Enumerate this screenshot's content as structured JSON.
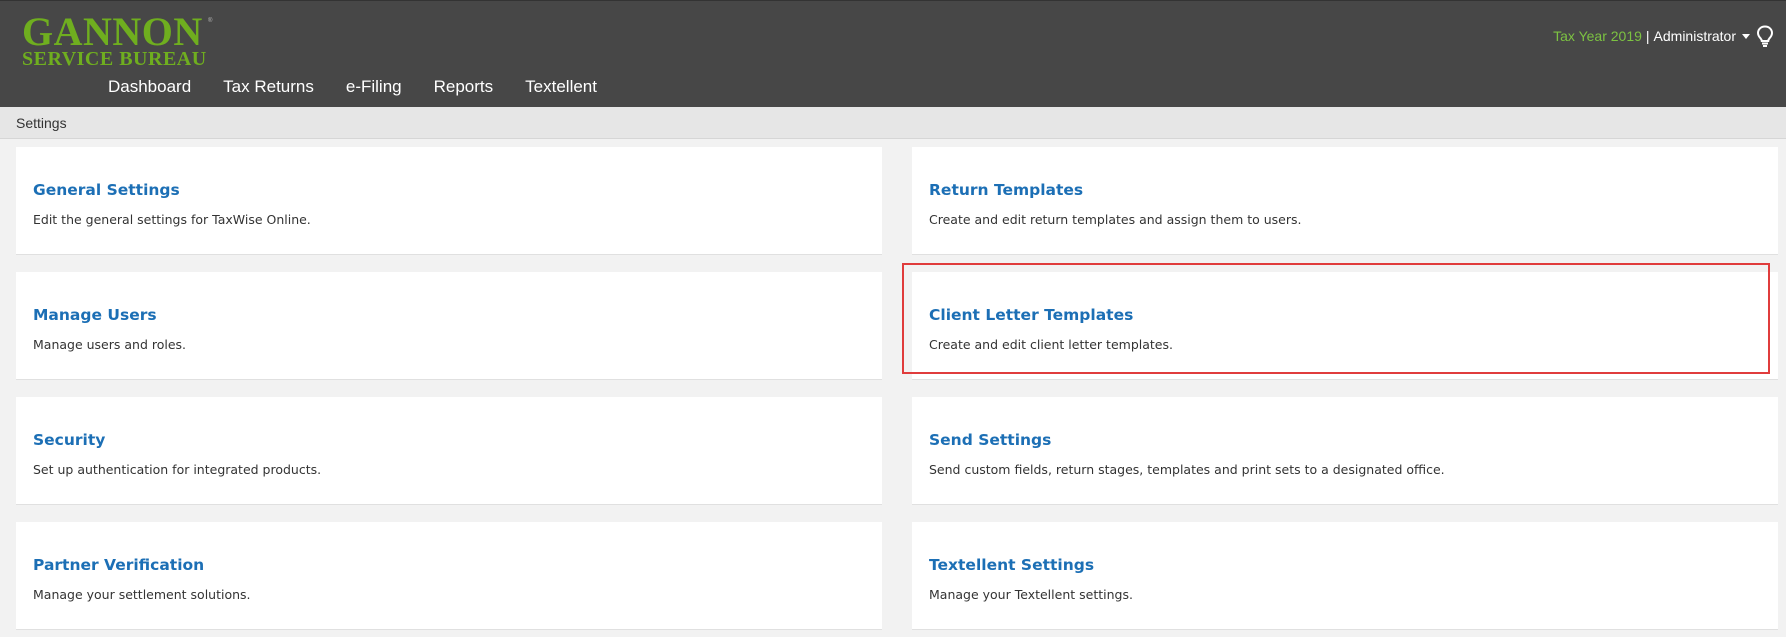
{
  "header": {
    "logo": {
      "line1": "GANNON",
      "line2": "SERVICE BUREAU",
      "tm": "®"
    },
    "nav": [
      {
        "label": "Dashboard"
      },
      {
        "label": "Tax Returns"
      },
      {
        "label": "e-Filing"
      },
      {
        "label": "Reports"
      },
      {
        "label": "Textellent"
      }
    ],
    "tax_year": "Tax Year 2019",
    "separator": "|",
    "user": "Administrator",
    "icons": {
      "caret": "caret-down-icon",
      "bulb": "lightbulb-icon"
    }
  },
  "breadcrumb": {
    "label": "Settings"
  },
  "cards": [
    {
      "title": "General Settings",
      "desc": "Edit the general settings for TaxWise Online."
    },
    {
      "title": "Return Templates",
      "desc": "Create and edit return templates and assign them to users."
    },
    {
      "title": "Manage Users",
      "desc": "Manage users and roles."
    },
    {
      "title": "Client Letter Templates",
      "desc": "Create and edit client letter templates."
    },
    {
      "title": "Security",
      "desc": "Set up authentication for integrated products."
    },
    {
      "title": "Send Settings",
      "desc": "Send custom fields, return stages, templates and print sets to a designated office."
    },
    {
      "title": "Partner Verification",
      "desc": "Manage your settlement solutions."
    },
    {
      "title": "Textellent Settings",
      "desc": "Manage your Textellent settings."
    }
  ],
  "colors": {
    "link": "#1c6fb5",
    "brand": "#6fae1f",
    "tax_year": "#7cc242",
    "highlight": "#e03c3c",
    "topbar": "#474747"
  }
}
